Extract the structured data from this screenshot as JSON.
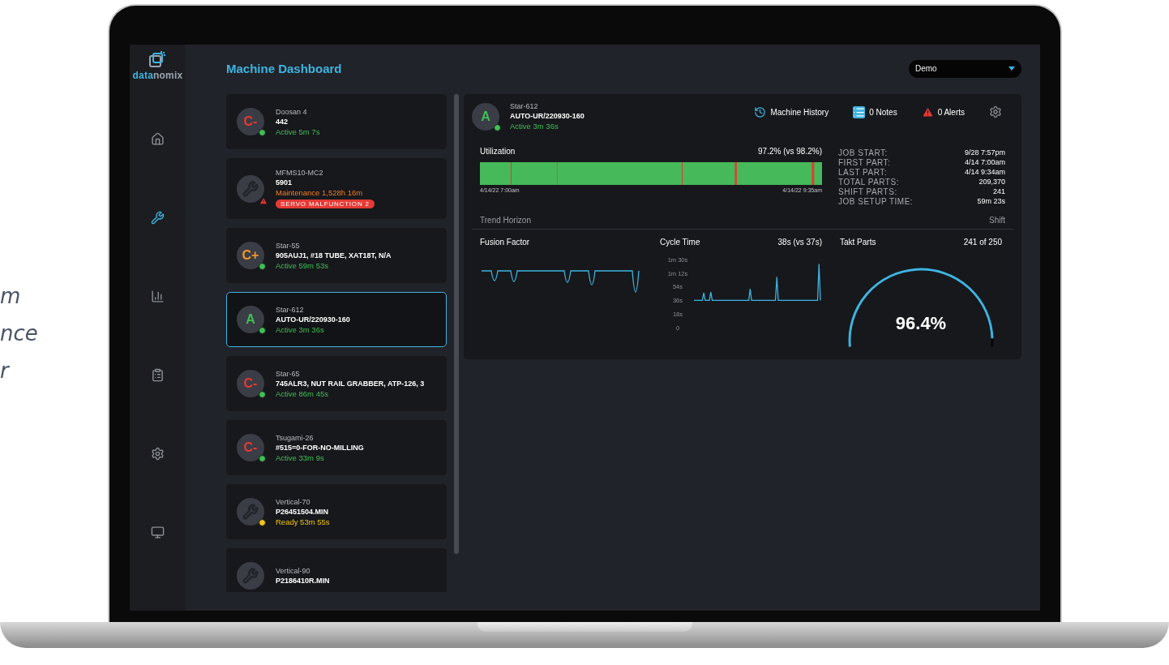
{
  "side_caption": [
    "m",
    "nce",
    "r"
  ],
  "sidebar": {
    "logo_parts": [
      "data",
      "nomix"
    ],
    "items": [
      {
        "kind": "home",
        "selected": false
      },
      {
        "kind": "wrench",
        "selected": true
      },
      {
        "kind": "chart",
        "selected": false
      },
      {
        "kind": "clipboard",
        "selected": false
      },
      {
        "kind": "gear",
        "selected": false
      },
      {
        "kind": "monitor",
        "selected": false
      }
    ]
  },
  "header": {
    "title": "Machine Dashboard",
    "dropdown": {
      "value": "Demo"
    }
  },
  "machines": [
    {
      "kind": "grade",
      "grade": {
        "label": "C-",
        "color": "#e53935"
      },
      "name": "Doosan 4",
      "job": "442",
      "status": "Active 5m 7s",
      "color": "#3fbf55",
      "alert": false,
      "selected": false
    },
    {
      "kind": "maintenance",
      "name": "MFMS10-MC2",
      "job": "5901",
      "status": "Maintenance 1,528h 16m",
      "alert": true,
      "badge": "SERVO MALFUNCTION 2",
      "selected": false
    },
    {
      "kind": "grade",
      "grade": {
        "label": "C+",
        "color": "#f0962a"
      },
      "name": "Star-55",
      "job": "905AUJ1, #18 TUBE, XAT18T, N/A",
      "status": "Active 59m 53s",
      "color": "#3fbf55",
      "alert": false,
      "selected": false
    },
    {
      "kind": "grade",
      "grade": {
        "label": "A",
        "color": "#3fbf55"
      },
      "name": "Star-612",
      "job": "AUTO-UR/220930-160",
      "status": "Active 3m 36s",
      "color": "#3fbf55",
      "alert": false,
      "selected": true
    },
    {
      "kind": "grade",
      "grade": {
        "label": "C-",
        "color": "#e53935"
      },
      "name": "Star-65",
      "job": "745ALR3, NUT RAIL GRABBER, ATP-126, 3",
      "status": "Active 86m 45s",
      "color": "#3fbf55",
      "alert": false,
      "selected": false
    },
    {
      "kind": "grade",
      "grade": {
        "label": "C-",
        "color": "#e53935"
      },
      "name": "Tsugami-26",
      "job": "#515=0-FOR-NO-MILLING",
      "status": "Active 33m 9s",
      "color": "#3fbf55",
      "alert": false,
      "selected": false
    },
    {
      "kind": "idle",
      "name": "Vertical-70",
      "job": "P26451504.MIN",
      "status": "Ready 53m 55s",
      "color": "#f0c419",
      "alert": false,
      "selected": false
    },
    {
      "kind": "idle",
      "name": "Vertical-90",
      "job": "P2186410R.MIN",
      "alert": false,
      "selected": false
    }
  ],
  "detail": {
    "kind": "grade",
    "grade": {
      "label": "A",
      "color": "#3fbf55"
    },
    "name": "Star-612",
    "job": "AUTO-UR/220930-160",
    "status": "Active 3m 36s",
    "color": "#3fbf55",
    "actions": [
      {
        "kind": "history",
        "label": "Machine History"
      },
      {
        "kind": "notes",
        "label": "0 Notes"
      },
      {
        "kind": "alerts",
        "label": "0 Alerts"
      },
      {
        "kind": "settings"
      }
    ],
    "utilization": {
      "label": "Utilization",
      "value": "97.2% (vs 98.2%)",
      "start": "4/14/22 7:00am",
      "end": "4/14/22 9:35am"
    },
    "stats": [
      {
        "label": "JOB START:",
        "value": "9/28 7:57pm"
      },
      {
        "label": "FIRST PART:",
        "value": "4/14 7:00am"
      },
      {
        "label": "LAST PART:",
        "value": "4/14 9:34am"
      },
      {
        "label": "TOTAL PARTS:",
        "value": "209,370"
      },
      {
        "label": "SHIFT PARTS:",
        "value": "241"
      },
      {
        "label": "JOB SETUP TIME:",
        "value": "59m 23s"
      }
    ],
    "trend": {
      "label": "Trend Horizon",
      "value": "Shift"
    },
    "fusion": {
      "title": "Fusion Factor"
    },
    "cycle": {
      "value": "38s (vs 37s)",
      "chart_data": {
        "type": "line",
        "title": "Cycle Time",
        "ylim": [
          0,
          90
        ],
        "yticks": [
          {
            "value": 0,
            "label": "0"
          },
          {
            "value": 18,
            "label": "18s"
          },
          {
            "value": 36,
            "label": "36s"
          },
          {
            "value": 54,
            "label": "54s"
          },
          {
            "value": 72,
            "label": "1m 12s"
          },
          {
            "value": 90,
            "label": "1m 30s"
          }
        ],
        "series": [
          {
            "color": "#3fb4e0",
            "values": [
              36,
              36,
              36,
              36,
              36,
              36,
              36,
              46,
              36,
              36,
              36,
              36,
              47,
              36,
              36,
              36,
              36,
              36,
              36,
              36,
              36,
              36,
              36,
              36,
              36,
              36,
              36,
              36,
              36,
              36,
              36,
              36,
              36,
              36,
              36,
              36,
              36,
              36,
              36,
              36,
              51,
              36,
              36,
              36,
              36,
              36,
              36,
              36,
              36,
              36,
              36,
              36,
              36,
              36,
              36,
              36,
              36,
              36,
              36,
              67,
              36,
              36,
              36,
              36,
              36,
              36,
              36,
              36,
              36,
              36,
              36,
              36,
              36,
              36,
              36,
              36,
              36,
              36,
              36,
              36,
              36,
              36,
              36,
              36,
              36,
              36,
              36,
              36,
              36,
              84,
              36
            ]
          }
        ]
      }
    },
    "takt": {
      "title": "Takt Parts",
      "value": "241 of 250",
      "level": 0.964,
      "reading": "96.4%"
    }
  }
}
